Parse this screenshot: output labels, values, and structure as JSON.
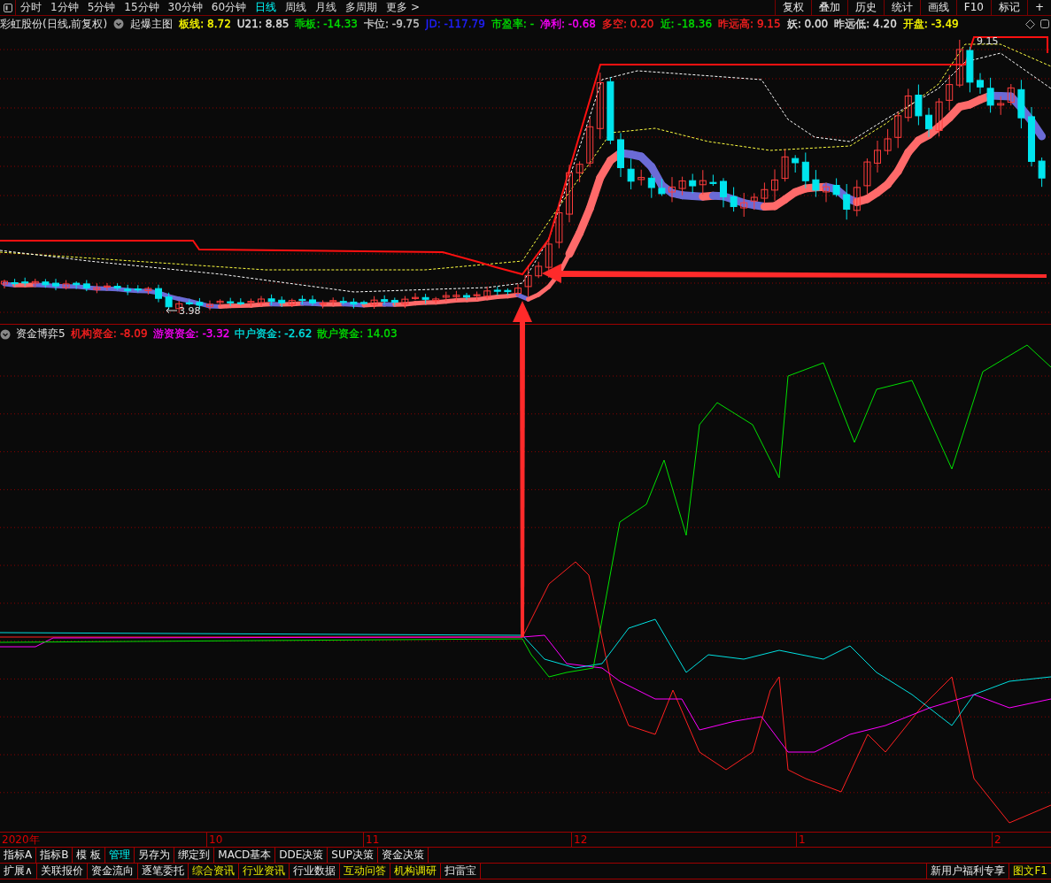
{
  "toolbar": {
    "periods": [
      {
        "label": "分时",
        "selected": false
      },
      {
        "label": "1分钟",
        "selected": false
      },
      {
        "label": "5分钟",
        "selected": false
      },
      {
        "label": "15分钟",
        "selected": false
      },
      {
        "label": "30分钟",
        "selected": false
      },
      {
        "label": "60分钟",
        "selected": false
      },
      {
        "label": "日线",
        "selected": true
      },
      {
        "label": "周线",
        "selected": false
      },
      {
        "label": "月线",
        "selected": false
      },
      {
        "label": "多周期",
        "selected": false
      },
      {
        "label": "更多 >",
        "selected": false
      }
    ],
    "buttons": [
      "复权",
      "叠加",
      "历史",
      "统计",
      "画线",
      "F10",
      "标记",
      "+"
    ]
  },
  "header": {
    "title": "彩虹股份(日线,前复权)",
    "indicator_name": "起爆主图",
    "values": [
      {
        "text": "板线: 8.72",
        "color": "#ffff00"
      },
      {
        "text": "U21: 8.85",
        "color": "#e0e0e0"
      },
      {
        "text": "乖板: -14.33",
        "color": "#00e000"
      },
      {
        "text": "卡位: -9.75",
        "color": "#c8c8c8"
      },
      {
        "text": "JD: -117.79",
        "color": "#2020ff"
      },
      {
        "text": "市盈率: -",
        "color": "#00e000"
      },
      {
        "text": "净利: -0.68",
        "color": "#ff00ff"
      },
      {
        "text": "多空: 0.20",
        "color": "#ff2020"
      },
      {
        "text": "近: -18.36",
        "color": "#00e000"
      },
      {
        "text": "昨远高: 9.15",
        "color": "#ff2020"
      },
      {
        "text": "妖: 0.00",
        "color": "#e0e0e0"
      },
      {
        "text": "昨远低: 4.20",
        "color": "#e0e0e0"
      },
      {
        "text": "开盘: -3.49",
        "color": "#ffff00"
      }
    ]
  },
  "main_chart": {
    "high_label": "9.15",
    "low_label": "3.98"
  },
  "fund_panel": {
    "name": "资金博弈5",
    "values": [
      {
        "text": "机构资金: -8.09",
        "color": "#ff2020"
      },
      {
        "text": "游资资金: -3.32",
        "color": "#ff00ff"
      },
      {
        "text": "中户资金: -2.62",
        "color": "#00e0e0"
      },
      {
        "text": "散户资金: 14.03",
        "color": "#00e000"
      }
    ]
  },
  "date_axis": [
    "2020年",
    "10",
    "11",
    "12",
    "1",
    "2"
  ],
  "tabs_row1": [
    {
      "label": "指标A",
      "selected": false
    },
    {
      "label": "指标B",
      "selected": false
    },
    {
      "label": "模 板",
      "selected": false
    },
    {
      "label": "管理",
      "selected": true
    },
    {
      "label": "另存为",
      "selected": false
    },
    {
      "label": "绑定到",
      "selected": false
    },
    {
      "label": "MACD基本",
      "selected": false
    },
    {
      "label": "DDE决策",
      "selected": false
    },
    {
      "label": "SUP决策",
      "selected": false
    },
    {
      "label": "资金决策",
      "selected": false
    }
  ],
  "tabs_row2": [
    {
      "label": "扩展∧",
      "highlighted": false
    },
    {
      "label": "关联报价",
      "highlighted": false
    },
    {
      "label": "资金流向",
      "highlighted": false
    },
    {
      "label": "逐笔委托",
      "highlighted": false
    },
    {
      "label": "综合资讯",
      "highlighted": true
    },
    {
      "label": "行业资讯",
      "highlighted": true
    },
    {
      "label": "行业数据",
      "highlighted": false
    },
    {
      "label": "互动问答",
      "highlighted": true
    },
    {
      "label": "机构调研",
      "highlighted": true
    },
    {
      "label": "扫雷宝",
      "highlighted": false
    }
  ],
  "promo": [
    {
      "label": "新用户福利专享",
      "highlighted": false
    },
    {
      "label": "图文F1",
      "highlighted": true
    }
  ]
}
